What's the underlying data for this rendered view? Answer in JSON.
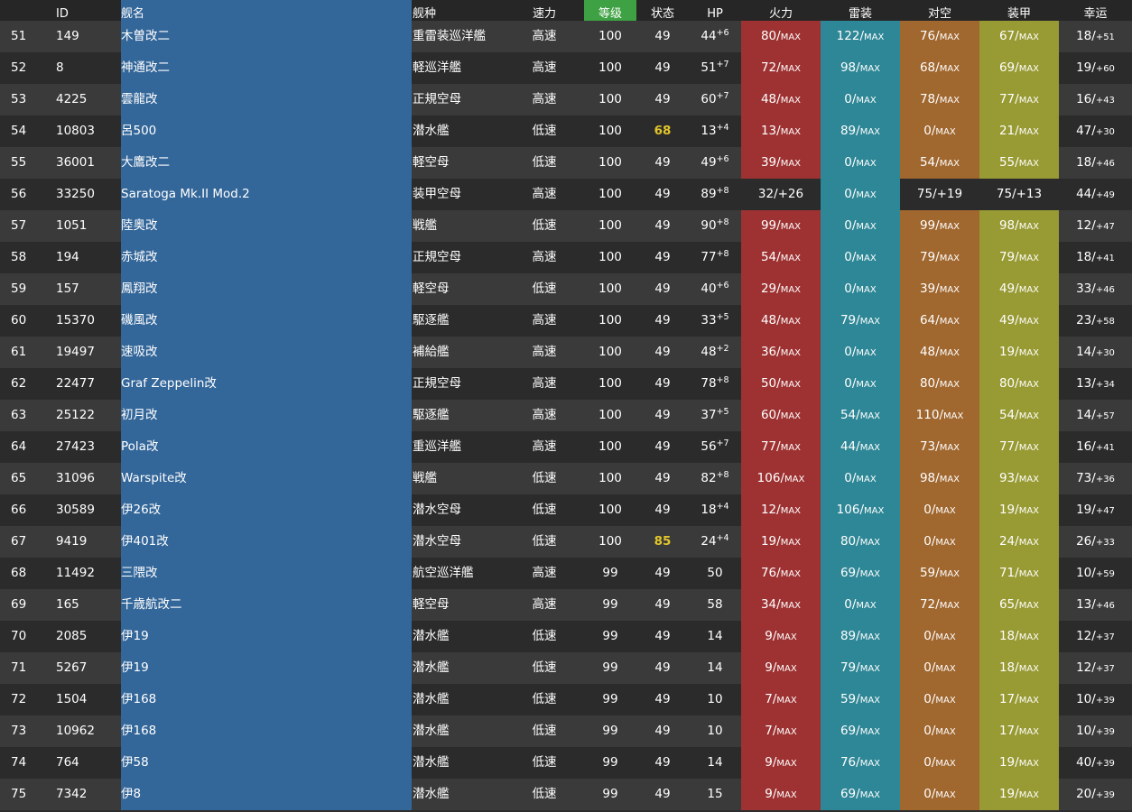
{
  "header": {
    "no": "",
    "id": "ID",
    "name": "舰名",
    "type": "舰种",
    "speed": "速力",
    "level": "等级",
    "condition": "状态",
    "hp": "HP",
    "firepower": "火力",
    "torpedo": "雷装",
    "antiair": "对空",
    "armor": "装甲",
    "luck": "幸运"
  },
  "max_label": "MAX",
  "colors": {
    "name_col": "#336699",
    "firepower": "#9e3232",
    "torpedo": "#2e8796",
    "antiair": "#a0672f",
    "armor": "#989a33",
    "level_header": "#3ea143",
    "condition_sparkle": "#e3c62b"
  },
  "rows": [
    {
      "no": "51",
      "id": "149",
      "name": "木曽改二",
      "type": "重雷装巡洋艦",
      "speed": "高速",
      "level": "100",
      "cond": "49",
      "hp": "44",
      "hp_bonus": "+6",
      "fp": "80/",
      "fp_max": true,
      "tp": "122/",
      "tp_max": true,
      "aa": "76/",
      "aa_max": true,
      "ar": "67/",
      "ar_max": true,
      "luck": "18/",
      "luck_add": "+51"
    },
    {
      "no": "52",
      "id": "8",
      "name": "神通改二",
      "type": "軽巡洋艦",
      "speed": "高速",
      "level": "100",
      "cond": "49",
      "hp": "51",
      "hp_bonus": "+7",
      "fp": "72/",
      "fp_max": true,
      "tp": "98/",
      "tp_max": true,
      "aa": "68/",
      "aa_max": true,
      "ar": "69/",
      "ar_max": true,
      "luck": "19/",
      "luck_add": "+60"
    },
    {
      "no": "53",
      "id": "4225",
      "name": "雲龍改",
      "type": "正規空母",
      "speed": "高速",
      "level": "100",
      "cond": "49",
      "hp": "60",
      "hp_bonus": "+7",
      "fp": "48/",
      "fp_max": true,
      "tp": "0/",
      "tp_max": true,
      "aa": "78/",
      "aa_max": true,
      "ar": "77/",
      "ar_max": true,
      "luck": "16/",
      "luck_add": "+43"
    },
    {
      "no": "54",
      "id": "10803",
      "name": "呂500",
      "type": "潜水艦",
      "speed": "低速",
      "level": "100",
      "cond": "68",
      "cond_warn": true,
      "hp": "13",
      "hp_bonus": "+4",
      "fp": "13/",
      "fp_max": true,
      "tp": "89/",
      "tp_max": true,
      "aa": "0/",
      "aa_max": true,
      "ar": "21/",
      "ar_max": true,
      "luck": "47/",
      "luck_add": "+30"
    },
    {
      "no": "55",
      "id": "36001",
      "name": "大鷹改二",
      "type": "軽空母",
      "speed": "低速",
      "level": "100",
      "cond": "49",
      "hp": "49",
      "hp_bonus": "+6",
      "fp": "39/",
      "fp_max": true,
      "tp": "0/",
      "tp_max": true,
      "aa": "54/",
      "aa_max": true,
      "ar": "55/",
      "ar_max": true,
      "luck": "18/",
      "luck_add": "+46"
    },
    {
      "no": "56",
      "id": "33250",
      "name": "Saratoga Mk.II Mod.2",
      "type": "装甲空母",
      "speed": "高速",
      "level": "100",
      "cond": "49",
      "hp": "89",
      "hp_bonus": "+8",
      "fp": "32/+26",
      "fp_max": false,
      "tp": "0/",
      "tp_max": true,
      "aa": "75/+19",
      "aa_max": false,
      "ar": "75/+13",
      "ar_max": false,
      "luck": "44/",
      "luck_add": "+49"
    },
    {
      "no": "57",
      "id": "1051",
      "name": "陸奥改",
      "type": "戦艦",
      "speed": "低速",
      "level": "100",
      "cond": "49",
      "hp": "90",
      "hp_bonus": "+8",
      "fp": "99/",
      "fp_max": true,
      "tp": "0/",
      "tp_max": true,
      "aa": "99/",
      "aa_max": true,
      "ar": "98/",
      "ar_max": true,
      "luck": "12/",
      "luck_add": "+47"
    },
    {
      "no": "58",
      "id": "194",
      "name": "赤城改",
      "type": "正規空母",
      "speed": "高速",
      "level": "100",
      "cond": "49",
      "hp": "77",
      "hp_bonus": "+8",
      "fp": "54/",
      "fp_max": true,
      "tp": "0/",
      "tp_max": true,
      "aa": "79/",
      "aa_max": true,
      "ar": "79/",
      "ar_max": true,
      "luck": "18/",
      "luck_add": "+41"
    },
    {
      "no": "59",
      "id": "157",
      "name": "鳳翔改",
      "type": "軽空母",
      "speed": "低速",
      "level": "100",
      "cond": "49",
      "hp": "40",
      "hp_bonus": "+6",
      "fp": "29/",
      "fp_max": true,
      "tp": "0/",
      "tp_max": true,
      "aa": "39/",
      "aa_max": true,
      "ar": "49/",
      "ar_max": true,
      "luck": "33/",
      "luck_add": "+46"
    },
    {
      "no": "60",
      "id": "15370",
      "name": "磯風改",
      "type": "駆逐艦",
      "speed": "高速",
      "level": "100",
      "cond": "49",
      "hp": "33",
      "hp_bonus": "+5",
      "fp": "48/",
      "fp_max": true,
      "tp": "79/",
      "tp_max": true,
      "aa": "64/",
      "aa_max": true,
      "ar": "49/",
      "ar_max": true,
      "luck": "23/",
      "luck_add": "+58"
    },
    {
      "no": "61",
      "id": "19497",
      "name": "速吸改",
      "type": "補給艦",
      "speed": "高速",
      "level": "100",
      "cond": "49",
      "hp": "48",
      "hp_bonus": "+2",
      "fp": "36/",
      "fp_max": true,
      "tp": "0/",
      "tp_max": true,
      "aa": "48/",
      "aa_max": true,
      "ar": "19/",
      "ar_max": true,
      "luck": "14/",
      "luck_add": "+30"
    },
    {
      "no": "62",
      "id": "22477",
      "name": "Graf Zeppelin改",
      "type": "正規空母",
      "speed": "高速",
      "level": "100",
      "cond": "49",
      "hp": "78",
      "hp_bonus": "+8",
      "fp": "50/",
      "fp_max": true,
      "tp": "0/",
      "tp_max": true,
      "aa": "80/",
      "aa_max": true,
      "ar": "80/",
      "ar_max": true,
      "luck": "13/",
      "luck_add": "+34"
    },
    {
      "no": "63",
      "id": "25122",
      "name": "初月改",
      "type": "駆逐艦",
      "speed": "高速",
      "level": "100",
      "cond": "49",
      "hp": "37",
      "hp_bonus": "+5",
      "fp": "60/",
      "fp_max": true,
      "tp": "54/",
      "tp_max": true,
      "aa": "110/",
      "aa_max": true,
      "ar": "54/",
      "ar_max": true,
      "luck": "14/",
      "luck_add": "+57"
    },
    {
      "no": "64",
      "id": "27423",
      "name": "Pola改",
      "type": "重巡洋艦",
      "speed": "高速",
      "level": "100",
      "cond": "49",
      "hp": "56",
      "hp_bonus": "+7",
      "fp": "77/",
      "fp_max": true,
      "tp": "44/",
      "tp_max": true,
      "aa": "73/",
      "aa_max": true,
      "ar": "77/",
      "ar_max": true,
      "luck": "16/",
      "luck_add": "+41"
    },
    {
      "no": "65",
      "id": "31096",
      "name": "Warspite改",
      "type": "戦艦",
      "speed": "低速",
      "level": "100",
      "cond": "49",
      "hp": "82",
      "hp_bonus": "+8",
      "fp": "106/",
      "fp_max": true,
      "tp": "0/",
      "tp_max": true,
      "aa": "98/",
      "aa_max": true,
      "ar": "93/",
      "ar_max": true,
      "luck": "73/",
      "luck_add": "+36"
    },
    {
      "no": "66",
      "id": "30589",
      "name": "伊26改",
      "type": "潜水空母",
      "speed": "低速",
      "level": "100",
      "cond": "49",
      "hp": "18",
      "hp_bonus": "+4",
      "fp": "12/",
      "fp_max": true,
      "tp": "106/",
      "tp_max": true,
      "aa": "0/",
      "aa_max": true,
      "ar": "19/",
      "ar_max": true,
      "luck": "19/",
      "luck_add": "+47"
    },
    {
      "no": "67",
      "id": "9419",
      "name": "伊401改",
      "type": "潜水空母",
      "speed": "低速",
      "level": "100",
      "cond": "85",
      "cond_warn": true,
      "hp": "24",
      "hp_bonus": "+4",
      "fp": "19/",
      "fp_max": true,
      "tp": "80/",
      "tp_max": true,
      "aa": "0/",
      "aa_max": true,
      "ar": "24/",
      "ar_max": true,
      "luck": "26/",
      "luck_add": "+33"
    },
    {
      "no": "68",
      "id": "11492",
      "name": "三隈改",
      "type": "航空巡洋艦",
      "speed": "高速",
      "level": "99",
      "cond": "49",
      "hp": "50",
      "hp_bonus": "",
      "fp": "76/",
      "fp_max": true,
      "tp": "69/",
      "tp_max": true,
      "aa": "59/",
      "aa_max": true,
      "ar": "71/",
      "ar_max": true,
      "luck": "10/",
      "luck_add": "+59"
    },
    {
      "no": "69",
      "id": "165",
      "name": "千歳航改二",
      "type": "軽空母",
      "speed": "高速",
      "level": "99",
      "cond": "49",
      "hp": "58",
      "hp_bonus": "",
      "fp": "34/",
      "fp_max": true,
      "tp": "0/",
      "tp_max": true,
      "aa": "72/",
      "aa_max": true,
      "ar": "65/",
      "ar_max": true,
      "luck": "13/",
      "luck_add": "+46"
    },
    {
      "no": "70",
      "id": "2085",
      "name": "伊19",
      "type": "潜水艦",
      "speed": "低速",
      "level": "99",
      "cond": "49",
      "hp": "14",
      "hp_bonus": "",
      "fp": "9/",
      "fp_max": true,
      "tp": "89/",
      "tp_max": true,
      "aa": "0/",
      "aa_max": true,
      "ar": "18/",
      "ar_max": true,
      "luck": "12/",
      "luck_add": "+37"
    },
    {
      "no": "71",
      "id": "5267",
      "name": "伊19",
      "type": "潜水艦",
      "speed": "低速",
      "level": "99",
      "cond": "49",
      "hp": "14",
      "hp_bonus": "",
      "fp": "9/",
      "fp_max": true,
      "tp": "79/",
      "tp_max": true,
      "aa": "0/",
      "aa_max": true,
      "ar": "18/",
      "ar_max": true,
      "luck": "12/",
      "luck_add": "+37"
    },
    {
      "no": "72",
      "id": "1504",
      "name": "伊168",
      "type": "潜水艦",
      "speed": "低速",
      "level": "99",
      "cond": "49",
      "hp": "10",
      "hp_bonus": "",
      "fp": "7/",
      "fp_max": true,
      "tp": "59/",
      "tp_max": true,
      "aa": "0/",
      "aa_max": true,
      "ar": "17/",
      "ar_max": true,
      "luck": "10/",
      "luck_add": "+39"
    },
    {
      "no": "73",
      "id": "10962",
      "name": "伊168",
      "type": "潜水艦",
      "speed": "低速",
      "level": "99",
      "cond": "49",
      "hp": "10",
      "hp_bonus": "",
      "fp": "7/",
      "fp_max": true,
      "tp": "69/",
      "tp_max": true,
      "aa": "0/",
      "aa_max": true,
      "ar": "17/",
      "ar_max": true,
      "luck": "10/",
      "luck_add": "+39"
    },
    {
      "no": "74",
      "id": "764",
      "name": "伊58",
      "type": "潜水艦",
      "speed": "低速",
      "level": "99",
      "cond": "49",
      "hp": "14",
      "hp_bonus": "",
      "fp": "9/",
      "fp_max": true,
      "tp": "76/",
      "tp_max": true,
      "aa": "0/",
      "aa_max": true,
      "ar": "19/",
      "ar_max": true,
      "luck": "40/",
      "luck_add": "+39"
    },
    {
      "no": "75",
      "id": "7342",
      "name": "伊8",
      "type": "潜水艦",
      "speed": "低速",
      "level": "99",
      "cond": "49",
      "hp": "15",
      "hp_bonus": "",
      "fp": "9/",
      "fp_max": true,
      "tp": "69/",
      "tp_max": true,
      "aa": "0/",
      "aa_max": true,
      "ar": "19/",
      "ar_max": true,
      "luck": "20/",
      "luck_add": "+39"
    }
  ]
}
